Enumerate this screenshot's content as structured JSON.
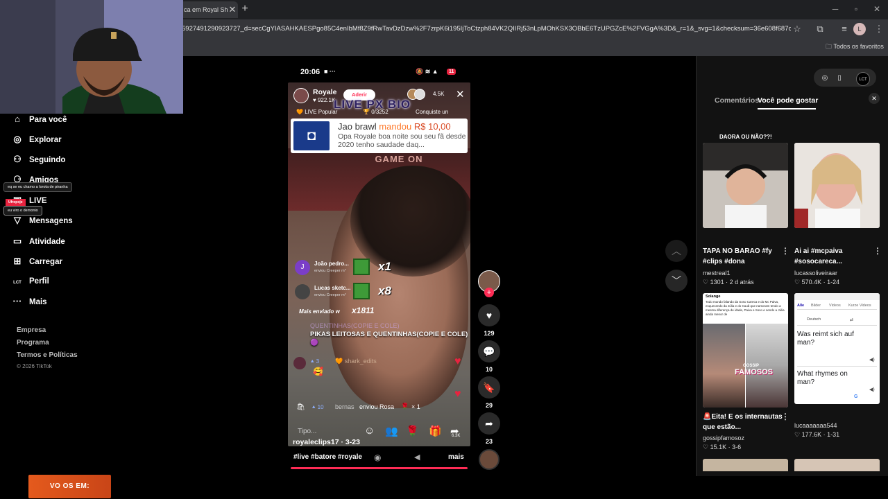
{
  "browser": {
    "tab_title": "ca em Royal Sh",
    "url": "5927491290923727_d=secCgYIASAHKAESPgo85C4enIbMf8Z9fRwTavDzDzw%2F7zrpK6i195IjToCtzph84VK2QIIRj53nLpMOhKSX3OBbE6TzUPGZcE%2FVGgA%3D&_r=1&_svg=1&checksum=36e608f687ce9734d05...",
    "bookmark_label": "Todos os favoritos",
    "profile_initial": "L"
  },
  "sidebar": {
    "items": [
      {
        "label": "Para você",
        "icon": "home-icon"
      },
      {
        "label": "Explorar",
        "icon": "compass-icon"
      },
      {
        "label": "Seguindo",
        "icon": "following-icon"
      },
      {
        "label": "Amigos",
        "icon": "friends-icon"
      },
      {
        "label": "LIVE",
        "icon": "live-icon"
      },
      {
        "label": "Mensagens",
        "icon": "messages-icon"
      },
      {
        "label": "Atividade",
        "icon": "activity-icon"
      },
      {
        "label": "Carregar",
        "icon": "upload-icon"
      },
      {
        "label": "Perfil",
        "icon": "profile-icon"
      },
      {
        "label": "Mais",
        "icon": "more-icon"
      }
    ],
    "footer_links": [
      "Empresa",
      "Programa",
      "Termos e Políticas"
    ],
    "copyright": "© 2026 TikTok"
  },
  "stream_overlays": {
    "tag1": "eq se eu chamo a lorota de piranha",
    "tag2_badge": "Ufropoje",
    "tag2": "eu viro o demonio",
    "promo": "VO   OS EM:"
  },
  "phone": {
    "time": "20:06",
    "battery": "11",
    "host_name": "Royale",
    "host_likes": "922.1K",
    "join_label": "Aderir",
    "viewers": "4.5K",
    "bio_overlay": "LIVE PX BIO",
    "live_popular": "LIVE Popular",
    "pop_progress": "0/3252",
    "conquiste": "Conquiste un",
    "background_sign": "GAME ON",
    "donation": {
      "name": "Jao brawl",
      "verb": "mandou",
      "amount": "R$ 10,00",
      "message": "Opa Royale boa noite sou seu fã desde 2020 tenho saudade daq..."
    },
    "gifts": [
      {
        "initial": "J",
        "name": "João pedro...",
        "sub": "enviou Creeper m°",
        "count": "x1"
      },
      {
        "initial": "",
        "name": "Lucas sketc...",
        "sub": "enviou Creeper m°",
        "count": "x8"
      }
    ],
    "mais_enviado": "Mais enviado w",
    "mais_count": "x1811",
    "chat_faded": "QUENTINHAS(COPIE E COLE)",
    "chat_main": "PIKAS LEITOSAS E QUENTINHAS(COPIE E COLE) 🟣",
    "shark_level": "3",
    "shark_name": "shark_edits",
    "berna_level": "10",
    "berna_text": "bernas",
    "berna_action": "enviou Rosa",
    "berna_count": "× 1",
    "comment_placeholder": "Tipo...",
    "share_count": "6.3K"
  },
  "video": {
    "username": "royaleclips17",
    "date": "3-23",
    "tags": "#live #batore #royale",
    "more_label": "mais"
  },
  "actions": {
    "likes": "129",
    "comments": "10",
    "saves": "29",
    "shares": "23"
  },
  "right_panel": {
    "tab_comments": "Comentários",
    "tab_suggestions": "Você pode gostar",
    "cards": [
      {
        "overlay": "DAORA OU NÃO??!",
        "title": "TAPA NO BARAO #fy #clips #dona",
        "author": "mestreal1",
        "likes": "1301",
        "date": "2 d atrás"
      },
      {
        "overlay": "",
        "title": "Ai ai #mcpaiva #sosocareca...",
        "author": "lucassoliveiraar",
        "likes": "570.4K",
        "date": "1-24"
      },
      {
        "overlay": "FAMOSOS",
        "title": "🚨Eita! E os internautas que estão...",
        "author": "gossipfamosoz",
        "likes": "15.1K",
        "date": "3-6"
      },
      {
        "overlay": "",
        "title": "",
        "author": "lucaaaaaaa544",
        "likes": "177.6K",
        "date": "1-31"
      }
    ],
    "google_card": {
      "tab_all": "Alle",
      "tab_images": "Bilder",
      "tab_videos": "Videos",
      "tab_short": "Kurze Videos",
      "lang_from": "Deutsch",
      "q1": "Was reimt sich auf man?",
      "q2": "What rhymes on man?"
    },
    "news_card": {
      "label": "Solange",
      "text": "Todo mundo falando da Soso Careca e do Mc Paiva, esquecendo da Júlia e do Cauã que namoram tendo a mesma diferença de idade, Paiva e Soso e sendo a Júlia ainda menor de",
      "brand_top": "GOSSIP",
      "brand": "FAMOSOS"
    }
  }
}
